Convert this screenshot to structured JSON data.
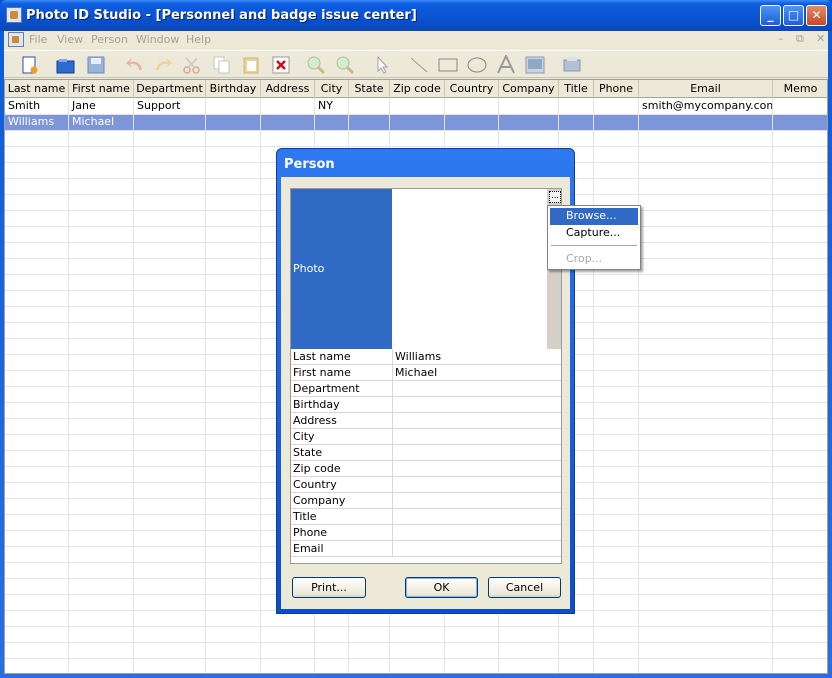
{
  "window": {
    "title": "Photo ID Studio - [Personnel and badge issue center]"
  },
  "menubar": {
    "items": [
      "File",
      "View",
      "Person",
      "Window",
      "Help"
    ]
  },
  "grid": {
    "columns": [
      "Last name",
      "First name",
      "Department",
      "Birthday",
      "Address",
      "City",
      "State",
      "Zip code",
      "Country",
      "Company",
      "Title",
      "Phone",
      "Email",
      "Memo"
    ],
    "rows": [
      [
        "Smith",
        "Jane",
        "Support",
        "",
        "",
        "NY",
        "",
        "",
        "",
        "",
        "",
        "",
        "smith@mycompany.com",
        ""
      ],
      [
        "Williams",
        "Michael",
        "",
        "",
        "",
        "",
        "",
        "",
        "",
        "",
        "",
        "",
        "",
        ""
      ]
    ],
    "selected_row": 1
  },
  "dialog": {
    "title": "Person",
    "photo_label": "Photo",
    "fields": [
      {
        "label": "Last name",
        "value": "Williams"
      },
      {
        "label": "First name",
        "value": "Michael"
      },
      {
        "label": "Department",
        "value": ""
      },
      {
        "label": "Birthday",
        "value": ""
      },
      {
        "label": "Address",
        "value": ""
      },
      {
        "label": "City",
        "value": ""
      },
      {
        "label": "State",
        "value": ""
      },
      {
        "label": "Zip code",
        "value": ""
      },
      {
        "label": "Country",
        "value": ""
      },
      {
        "label": "Company",
        "value": ""
      },
      {
        "label": "Title",
        "value": ""
      },
      {
        "label": "Phone",
        "value": ""
      },
      {
        "label": "Email",
        "value": ""
      }
    ],
    "print_label": "Print...",
    "ok_label": "OK",
    "cancel_label": "Cancel"
  },
  "context_menu": {
    "items": [
      {
        "label": "Browse...",
        "state": "highlighted"
      },
      {
        "label": "Capture...",
        "state": "normal"
      },
      {
        "label": "Crop...",
        "state": "disabled"
      }
    ]
  },
  "colors": {
    "selection": "#316ac5",
    "title_bar": "#0a52cf",
    "row_selected": "#7d95d9"
  }
}
